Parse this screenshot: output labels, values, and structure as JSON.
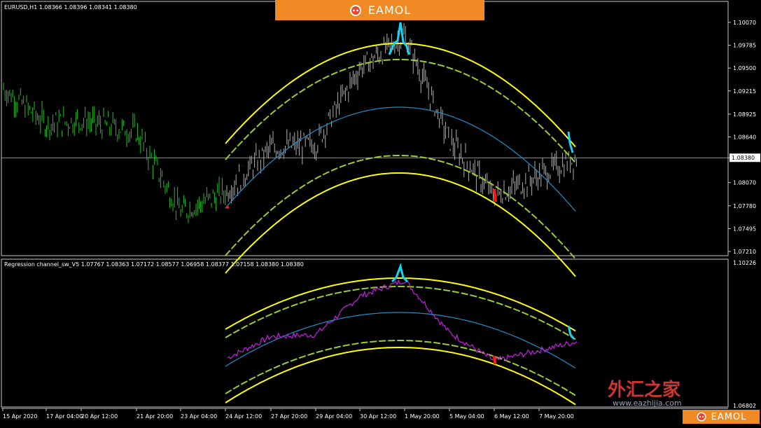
{
  "brand": {
    "name": "EAMOL",
    "accent": "#f08a24",
    "icon": "robot-face-icon"
  },
  "watermark": {
    "text": "外汇之家",
    "url": "www.eazhijia.com"
  },
  "main_panel": {
    "header": "EURUSD,H1  1.08366 1.08396 1.08341 1.08380",
    "y_ticks": [
      "1.10070",
      "1.09785",
      "1.09500",
      "1.09215",
      "1.08925",
      "1.08640",
      "1.08380",
      "1.08070",
      "1.07780",
      "1.07495",
      "1.07210"
    ],
    "current_price": "1.08380"
  },
  "sub_panel": {
    "header": "Regression channel_sw_V5 1.07767 1.08363 1.07172 1.08577 1.06958 1.08377 1.07158 1.08380 1.08380",
    "y_ticks": [
      "1.10226",
      "1.06802"
    ]
  },
  "x_ticks": [
    "15 Apr 2020",
    "17 Apr 04:00",
    "20 Apr 12:00",
    "21 Apr 20:00",
    "23 Apr 04:00",
    "24 Apr 12:00",
    "27 Apr 20:00",
    "29 Apr 04:00",
    "30 Apr 12:00",
    "1 May 20:00",
    "5 May 04:00",
    "6 May 12:00",
    "7 May 20:00"
  ],
  "chart_data": [
    {
      "type": "line",
      "title": "EURUSD,H1",
      "ylim": [
        1.0721,
        1.1007
      ],
      "series": [
        {
          "name": "EURUSD,H1",
          "x": [
            "15 Apr 2020",
            "17 Apr 04:00",
            "20 Apr 12:00",
            "21 Apr 20:00",
            "23 Apr 04:00",
            "24 Apr 12:00",
            "27 Apr 20:00",
            "29 Apr 04:00",
            "30 Apr 12:00",
            "1 May 20:00",
            "5 May 04:00",
            "6 May 12:00",
            "7 May 20:00"
          ],
          "values": [
            1.0925,
            1.088,
            1.0885,
            1.087,
            1.077,
            1.0795,
            1.085,
            1.0855,
            1.095,
            1.099,
            1.086,
            1.079,
            1.0838
          ]
        }
      ],
      "colors": {
        "bars_before": "#1fc11f",
        "bars_after": "#b0b0b0",
        "regression": "#1e90c8",
        "inner_channel": "#9acd32",
        "outer_channel": "#ffff00",
        "signal_up": "#19d2f0",
        "signal_down": "#ff1a1a"
      }
    },
    {
      "type": "line",
      "title": "Regression channel_sw_V5",
      "ylim": [
        1.06802,
        1.10226
      ],
      "series": [
        {
          "name": "Regression channel_sw_V5",
          "x": [
            "24 Apr 12:00",
            "27 Apr 20:00",
            "29 Apr 04:00",
            "30 Apr 12:00",
            "1 May 20:00",
            "5 May 04:00",
            "6 May 12:00",
            "7 May 20:00"
          ],
          "values": [
            1.0775,
            1.085,
            1.0855,
            1.095,
            1.099,
            1.086,
            1.079,
            1.0838
          ]
        }
      ],
      "colors": {
        "line": "#c81ee6"
      }
    }
  ]
}
